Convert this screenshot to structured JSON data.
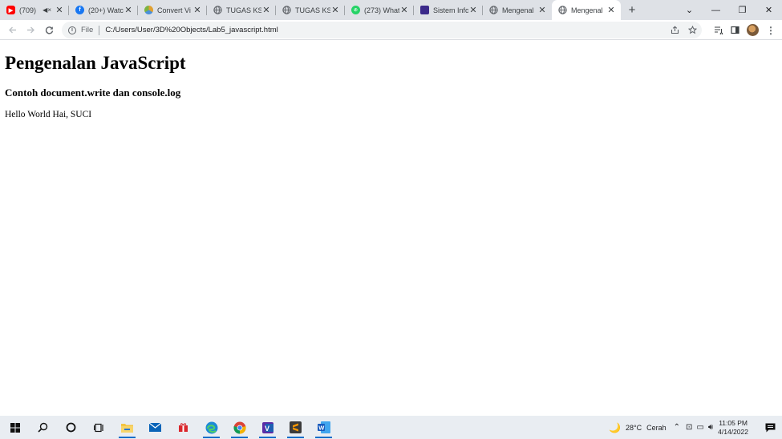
{
  "browser": {
    "tabs": [
      {
        "title": "(709)",
        "favicon": "youtube-icon",
        "color": "#ff0000",
        "muted": true
      },
      {
        "title": "(20+) Watc",
        "favicon": "facebook-icon",
        "color": "#1877f2"
      },
      {
        "title": "Convert Vi",
        "favicon": "convert-icon",
        "color": "#e0a030"
      },
      {
        "title": "TUGAS KSI",
        "favicon": "globe-icon",
        "color": "#5f6368"
      },
      {
        "title": "TUGAS KSI",
        "favicon": "globe-icon",
        "color": "#5f6368"
      },
      {
        "title": "(273) What",
        "favicon": "whatsapp-icon",
        "color": "#25d366"
      },
      {
        "title": "Sistem Info",
        "favicon": "university-icon",
        "color": "#3b2a8a"
      },
      {
        "title": "Mengenal",
        "favicon": "globe-icon",
        "color": "#5f6368"
      },
      {
        "title": "Mengenal",
        "favicon": "globe-icon",
        "color": "#5f6368",
        "active": true
      }
    ],
    "address": {
      "scheme": "File",
      "url": "C:/Users/User/3D%20Objects/Lab5_javascript.html"
    }
  },
  "page": {
    "heading": "Pengenalan JavaScript",
    "subheading": "Contoh document.write dan console.log",
    "body_text": "Hello World Hai, SUCI"
  },
  "taskbar": {
    "weather": {
      "temp": "28°C",
      "condition": "Cerah"
    },
    "clock": {
      "time": "11:05 PM",
      "date": "4/14/2022"
    }
  }
}
